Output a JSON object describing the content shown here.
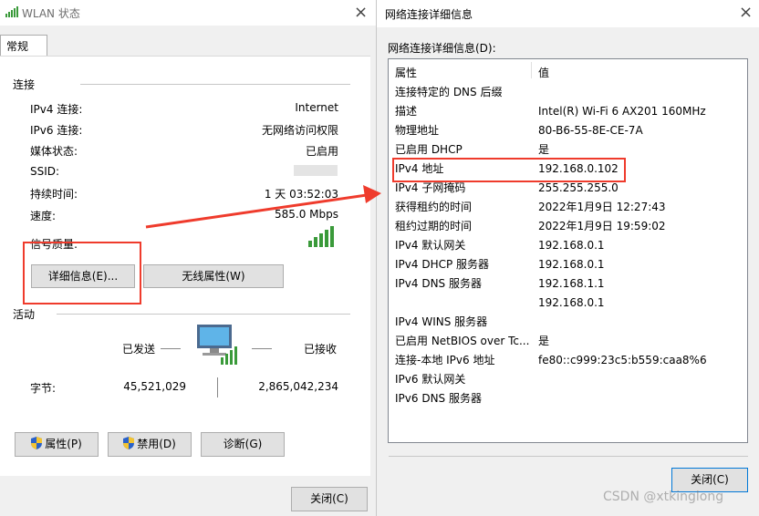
{
  "left": {
    "title": "WLAN 状态",
    "close_glyph": "×",
    "tab": "常规",
    "connection_group": "连接",
    "rows": [
      {
        "label": "IPv4 连接:",
        "value": "Internet"
      },
      {
        "label": "IPv6 连接:",
        "value": "无网络访问权限"
      },
      {
        "label": "媒体状态:",
        "value": "已启用"
      },
      {
        "label": "SSID:",
        "value": ""
      },
      {
        "label": "持续时间:",
        "value": "1 天 03:52:03"
      },
      {
        "label": "速度:",
        "value": "585.0 Mbps"
      }
    ],
    "signal_label": "信号质量:",
    "details_button": "详细信息(E)...",
    "wireless_props_button": "无线属性(W)",
    "activity_group": "活动",
    "sent_label": "已发送",
    "received_label": "已接收",
    "bytes_label": "字节:",
    "bytes_sent": "45,521,029",
    "bytes_received": "2,865,042,234",
    "properties_button": "属性(P)",
    "disable_button": "禁用(D)",
    "diagnose_button": "诊断(G)",
    "close_button": "关闭(C)"
  },
  "right": {
    "title": "网络连接详细信息",
    "close_glyph": "×",
    "list_label": "网络连接详细信息(D):",
    "col_property": "属性",
    "col_value": "值",
    "rows": [
      {
        "k": "连接特定的 DNS 后缀",
        "v": ""
      },
      {
        "k": "描述",
        "v": "Intel(R) Wi-Fi 6 AX201 160MHz"
      },
      {
        "k": "物理地址",
        "v": "80-B6-55-8E-CE-7A"
      },
      {
        "k": "已启用 DHCP",
        "v": "是"
      },
      {
        "k": "IPv4 地址",
        "v": "192.168.0.102"
      },
      {
        "k": "IPv4 子网掩码",
        "v": "255.255.255.0"
      },
      {
        "k": "获得租约的时间",
        "v": "2022年1月9日 12:27:43"
      },
      {
        "k": "租约过期的时间",
        "v": "2022年1月9日 19:59:02"
      },
      {
        "k": "IPv4 默认网关",
        "v": "192.168.0.1"
      },
      {
        "k": "IPv4 DHCP 服务器",
        "v": "192.168.0.1"
      },
      {
        "k": "IPv4 DNS 服务器",
        "v": "192.168.1.1"
      },
      {
        "k": "",
        "v": "192.168.0.1"
      },
      {
        "k": "IPv4 WINS 服务器",
        "v": ""
      },
      {
        "k": "已启用 NetBIOS over Tc...",
        "v": "是"
      },
      {
        "k": "连接-本地 IPv6 地址",
        "v": "fe80::c999:23c5:b559:caa8%6"
      },
      {
        "k": "IPv6 默认网关",
        "v": ""
      },
      {
        "k": "IPv6 DNS 服务器",
        "v": ""
      }
    ],
    "close_button": "关闭(C)"
  },
  "watermark": "CSDN @xtkinglong",
  "colors": {
    "annotation_red": "#ef3b2c",
    "focus_blue": "#0078d7",
    "signal_green": "#3a9a3a"
  }
}
